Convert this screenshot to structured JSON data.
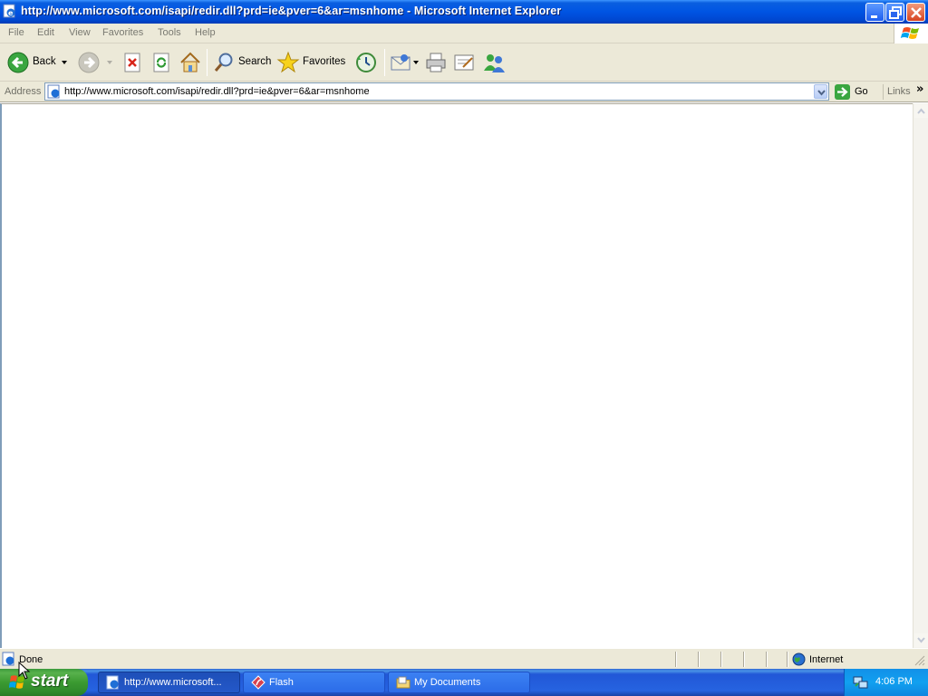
{
  "window": {
    "title": "http://www.microsoft.com/isapi/redir.dll?prd=ie&pver=6&ar=msnhome - Microsoft Internet Explorer"
  },
  "menu": [
    "File",
    "Edit",
    "View",
    "Favorites",
    "Tools",
    "Help"
  ],
  "toolbar": {
    "back_label": "Back",
    "search_label": "Search",
    "favorites_label": "Favorites"
  },
  "address": {
    "label": "Address",
    "url": "http://www.microsoft.com/isapi/redir.dll?prd=ie&pver=6&ar=msnhome",
    "go_label": "Go",
    "links_label": "Links",
    "links_chevron": "»"
  },
  "status": {
    "text": "Done",
    "zone": "Internet"
  },
  "taskbar": {
    "start_label": "start",
    "tasks": [
      {
        "label": "http://www.microsoft...",
        "active": true
      },
      {
        "label": "Flash",
        "active": false
      },
      {
        "label": "My Documents",
        "active": false
      }
    ],
    "clock": "4:06 PM"
  },
  "colors": {
    "titlebar_blue": "#0054e3",
    "chrome": "#ece9d8",
    "start_green": "#3b9a31",
    "tray_blue": "#11a0f0"
  }
}
